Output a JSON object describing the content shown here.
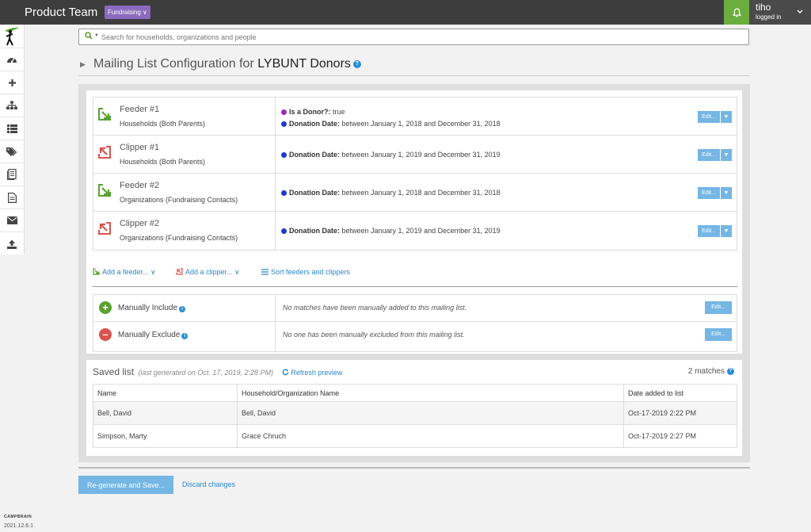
{
  "topbar": {
    "team_title": "Product Team",
    "team_badge": "Fundraising ∨",
    "user_name": "tiho",
    "user_sub": "logged in"
  },
  "footer": {
    "brand": "CAMPBRAIN",
    "version": "2021.12.6.1"
  },
  "search": {
    "placeholder": "Search for households, organizations and people"
  },
  "heading": {
    "prefix": "Mailing List Configuration for ",
    "name": "LYBUNT Donors"
  },
  "colors": {
    "accent": "#74b6e4",
    "link": "#2a87c8",
    "feeder_green": "#5aa132",
    "clipper_red": "#d9534f",
    "topbar": "#3d3d3d",
    "badge_purple": "#8b6bbf"
  },
  "rules": [
    {
      "kind": "feeder",
      "title": "Feeder #1",
      "subtitle": "Households (Both Parents)",
      "criteria": [
        {
          "dot": "purple",
          "label": "Is a Donor?:",
          "value": " true"
        },
        {
          "dot": "blue",
          "label": "Donation Date:",
          "value": " between January 1, 2018 and December 31, 2018"
        }
      ],
      "edit": "Edit..."
    },
    {
      "kind": "clipper",
      "title": "Clipper #1",
      "subtitle": "Households (Both Parents)",
      "criteria": [
        {
          "dot": "blue",
          "label": "Donation Date:",
          "value": " between January 1, 2019 and December 31, 2019"
        }
      ],
      "edit": "Edit..."
    },
    {
      "kind": "feeder",
      "title": "Feeder #2",
      "subtitle": "Organizations (Fundraising Contacts)",
      "criteria": [
        {
          "dot": "blue",
          "label": "Donation Date:",
          "value": " between January 1, 2018 and December 31, 2018"
        }
      ],
      "edit": "Edit..."
    },
    {
      "kind": "clipper",
      "title": "Clipper #2",
      "subtitle": "Organizations (Fundraising Contacts)",
      "criteria": [
        {
          "dot": "blue",
          "label": "Donation Date:",
          "value": " between January 1, 2019 and December 31, 2019"
        }
      ],
      "edit": "Edit..."
    }
  ],
  "actions": {
    "add_feeder": "Add a feeder... ∨",
    "add_clipper": "Add a clipper... ∨",
    "sort": "Sort feeders and clippers"
  },
  "manual": {
    "include_label": "Manually Include",
    "include_text": "No matches have been manually added to this mailing list.",
    "exclude_label": "Manually Exclude",
    "exclude_text": "No one has been manually excluded from this mailing list.",
    "edit": "Edit..."
  },
  "saved": {
    "title": "Saved list",
    "note": "(last generated on Oct. 17, 2019, 2:28 PM)",
    "refresh": "Refresh preview",
    "matches": "2 matches",
    "columns": [
      "Name",
      "Household/Organization Name",
      "Date added to list"
    ],
    "rows": [
      [
        "Bell, David",
        "Bell, David",
        "Oct-17-2019 2:22 PM"
      ],
      [
        "Simpson, Marty",
        "Grace Chruch",
        "Oct-17-2019 2:27 PM"
      ]
    ]
  },
  "buttons": {
    "regenerate": "Re-generate and Save...",
    "discard": "Discard changes"
  }
}
